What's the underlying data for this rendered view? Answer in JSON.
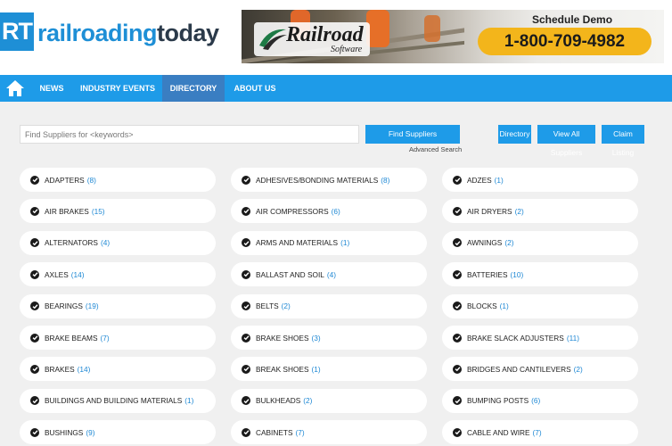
{
  "logo": {
    "box": "RT",
    "word_a": "railroading",
    "word_b": "today"
  },
  "banner": {
    "brand": "Railroad",
    "brand_sub": "Software",
    "cta": "Schedule Demo",
    "phone": "1-800-709-4982"
  },
  "nav": {
    "items": [
      "NEWS",
      "INDUSTRY EVENTS",
      "DIRECTORY",
      "ABOUT US"
    ],
    "active": "DIRECTORY"
  },
  "search": {
    "placeholder": "Find Suppliers for <keywords>",
    "find_label": "Find Suppliers",
    "advanced": "Advanced Search"
  },
  "actions": {
    "directory": "Directory",
    "view_all": "View All Suppliers",
    "claim": "Claim Listing"
  },
  "categories": [
    {
      "name": "ADAPTERS",
      "count": "(8)"
    },
    {
      "name": "ADHESIVES/BONDING MATERIALS",
      "count": "(8)"
    },
    {
      "name": "ADZES",
      "count": "(1)"
    },
    {
      "name": "AIR BRAKES",
      "count": "(15)"
    },
    {
      "name": "AIR COMPRESSORS",
      "count": "(6)"
    },
    {
      "name": "AIR DRYERS",
      "count": "(2)"
    },
    {
      "name": "ALTERNATORS",
      "count": "(4)"
    },
    {
      "name": "ARMS AND MATERIALS",
      "count": "(1)"
    },
    {
      "name": "AWNINGS",
      "count": "(2)"
    },
    {
      "name": "AXLES",
      "count": "(14)"
    },
    {
      "name": "BALLAST AND SOIL",
      "count": "(4)"
    },
    {
      "name": "BATTERIES",
      "count": "(10)"
    },
    {
      "name": "BEARINGS",
      "count": "(19)"
    },
    {
      "name": "BELTS",
      "count": "(2)"
    },
    {
      "name": "BLOCKS",
      "count": "(1)"
    },
    {
      "name": "BRAKE BEAMS",
      "count": "(7)"
    },
    {
      "name": "BRAKE SHOES",
      "count": "(3)"
    },
    {
      "name": "BRAKE SLACK ADJUSTERS",
      "count": "(11)"
    },
    {
      "name": "BRAKES",
      "count": "(14)"
    },
    {
      "name": "BREAK SHOES",
      "count": "(1)"
    },
    {
      "name": "BRIDGES AND CANTILEVERS",
      "count": "(2)"
    },
    {
      "name": "BUILDINGS AND BUILDING MATERIALS",
      "count": "(1)"
    },
    {
      "name": "BULKHEADS",
      "count": "(2)"
    },
    {
      "name": "BUMPING POSTS",
      "count": "(6)"
    },
    {
      "name": "BUSHINGS",
      "count": "(9)"
    },
    {
      "name": "CABINETS",
      "count": "(7)"
    },
    {
      "name": "CABLE AND WIRE",
      "count": "(7)"
    }
  ]
}
